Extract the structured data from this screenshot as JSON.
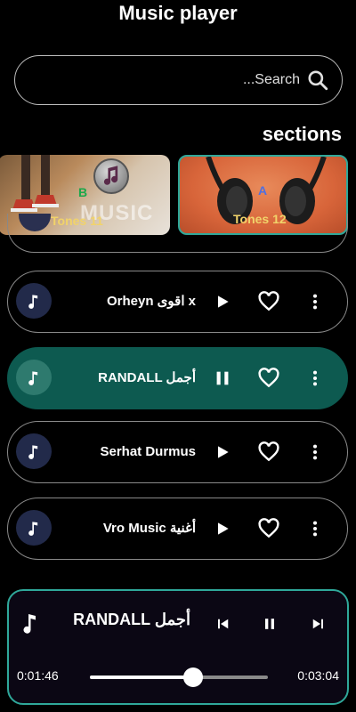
{
  "app": {
    "title": "Music player"
  },
  "search": {
    "placeholder": "...Search"
  },
  "sections": {
    "label": "sections",
    "cards": [
      {
        "letter": "B",
        "name": "Tones 11",
        "overlay_text": "MUSIC"
      },
      {
        "letter": "A",
        "name": "Tones 12"
      }
    ]
  },
  "songs": [
    {
      "title": "Orheyn  اقوى x",
      "state": "play",
      "active": false
    },
    {
      "title": "RANDALL  أجمل",
      "state": "pause",
      "active": true
    },
    {
      "title": "Serhat Durmus",
      "state": "play",
      "active": false
    },
    {
      "title": "Vro Music  أغنية",
      "state": "play",
      "active": false
    }
  ],
  "player": {
    "title": "RANDALL  أجمل",
    "current_time": "0:01:46",
    "total_time": "0:03:04",
    "progress": 0.58
  },
  "colors": {
    "background": "#000000",
    "accent": "#2fa89a",
    "active_row": "#0d5a50",
    "card_text": "#f1d36a"
  }
}
